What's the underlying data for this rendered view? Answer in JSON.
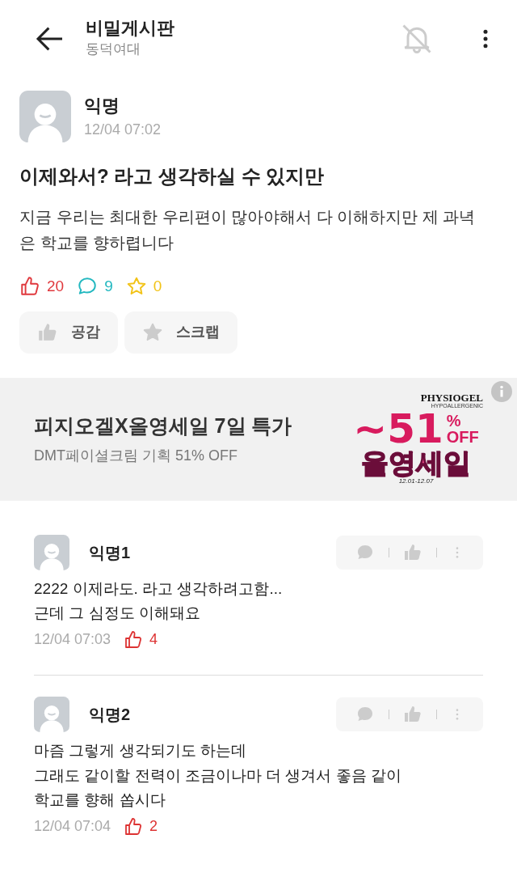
{
  "header": {
    "title": "비밀게시판",
    "subtitle": "동덕여대",
    "notifications_on": false
  },
  "post": {
    "author": "익명",
    "time": "12/04 07:02",
    "title": "이제와서? 라고 생각하실 수 있지만",
    "body": "지금 우리는 최대한 우리편이 많아야해서 다 이해하지만 제 과녁은 학교를 향하렵니다",
    "stats": [
      {
        "kind": "like",
        "count": "20",
        "color": "#e0393e"
      },
      {
        "kind": "comment",
        "count": "9",
        "color": "#23b8c0"
      },
      {
        "kind": "scrap",
        "count": "0",
        "color": "#f2c318"
      }
    ],
    "actions": [
      {
        "kind": "like",
        "label": "공감"
      },
      {
        "kind": "scrap",
        "label": "스크랩"
      }
    ]
  },
  "ad": {
    "title": "피지오겔X올영세일 7일 특가",
    "subtitle": "DMT페이셜크림 기획 51% OFF",
    "brand": "PHYSIOGEL",
    "brand_tagline": "HYPOALLERGENIC",
    "discount": "~51",
    "percent": "%",
    "off": "OFF",
    "sale": "올영세일",
    "dates": "12.01-12.07"
  },
  "comments": [
    {
      "author": "익명1",
      "text": "2222 이제라도. 라고 생각하려고함...\n근데 그 심정도 이해돼요",
      "time": "12/04 07:03",
      "likes": "4"
    },
    {
      "author": "익명2",
      "text": "마즘 그렇게 생각되기도 하는데\n그래도 같이할 전력이 조금이나마 더 생겨서 좋음 같이\n학교를 향해 쏩시다",
      "time": "12/04 07:04",
      "likes": "2"
    }
  ]
}
